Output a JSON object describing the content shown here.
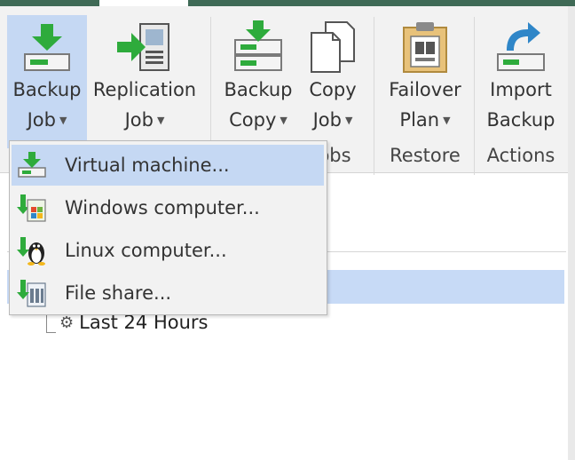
{
  "ribbon": {
    "buttons": [
      {
        "line1": "Backup",
        "line2": "Job",
        "icon": "backup-job-icon"
      },
      {
        "line1": "Replication",
        "line2": "Job",
        "icon": "replication-job-icon"
      },
      {
        "line1": "Backup",
        "line2": "Copy",
        "icon": "backup-copy-icon"
      },
      {
        "line1": "Copy",
        "line2": "Job",
        "icon": "copy-job-icon"
      },
      {
        "line1": "Failover",
        "line2": "Plan",
        "icon": "failover-plan-icon"
      },
      {
        "line1": "Import",
        "line2": "Backup",
        "icon": "import-backup-icon"
      }
    ],
    "groups": [
      {
        "label": "obs"
      },
      {
        "label": "Restore"
      },
      {
        "label": "Actions"
      }
    ]
  },
  "menu": {
    "items": [
      {
        "label": "Virtual machine...",
        "icon": "virtual-machine-icon"
      },
      {
        "label": "Windows computer...",
        "icon": "windows-computer-icon"
      },
      {
        "label": "Linux computer...",
        "icon": "linux-computer-icon"
      },
      {
        "label": "File share...",
        "icon": "file-share-icon"
      }
    ]
  },
  "tree": {
    "item_label": "Last 24 Hours"
  },
  "colors": {
    "accent_green": "#2eab3c",
    "selection_blue": "#c5d8f3",
    "ribbon_bg": "#f2f2f2",
    "top_strip": "#3f6a56"
  }
}
